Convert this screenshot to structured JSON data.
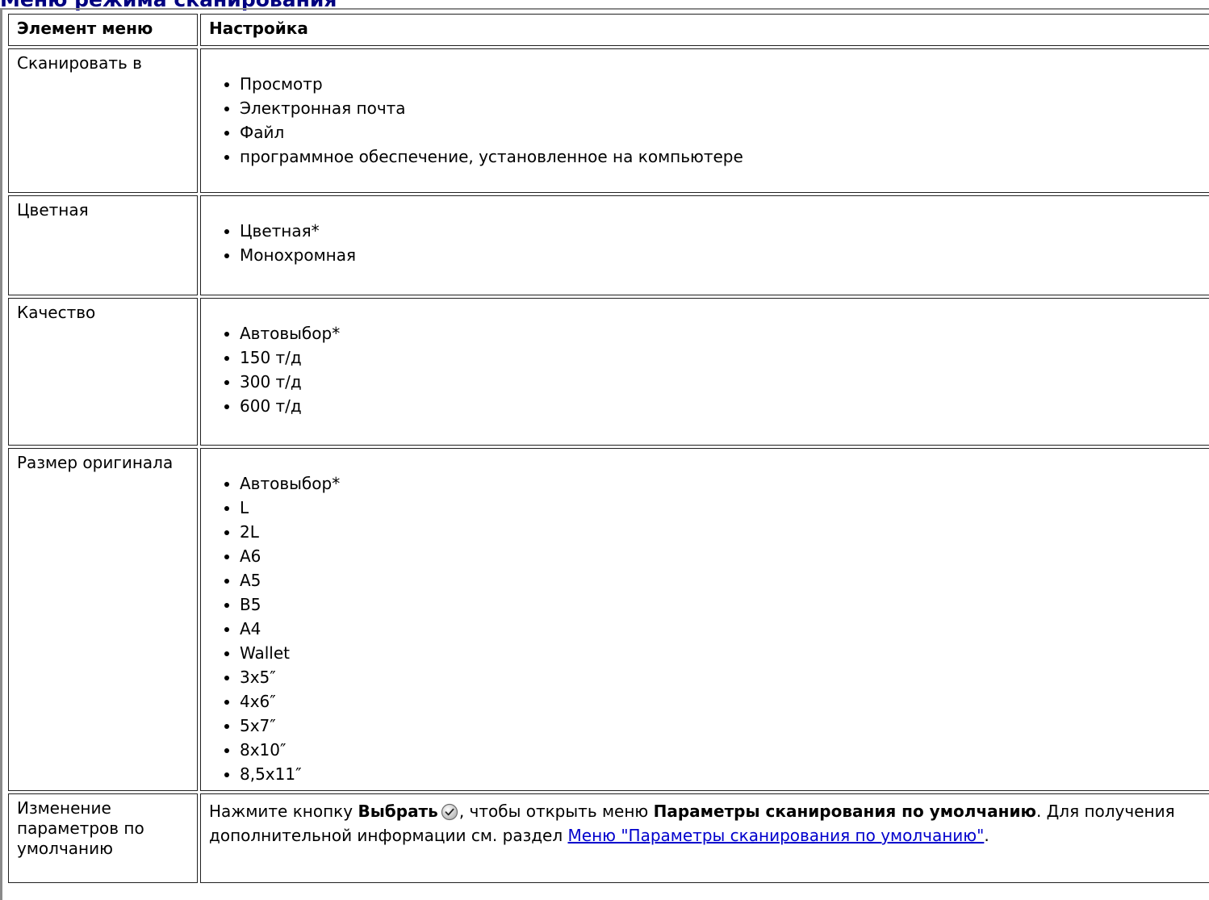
{
  "heading": "Меню режима сканирования",
  "table": {
    "header_item": "Элемент меню",
    "header_setting": "Настройка",
    "rows": [
      {
        "item": "Сканировать в",
        "options": [
          "Просмотр",
          "Электронная почта",
          "Файл",
          "программное обеспечение, установленное на компьютере"
        ]
      },
      {
        "item": "Цветная",
        "options": [
          "Цветная*",
          "Монохромная"
        ]
      },
      {
        "item": "Качество",
        "options": [
          "Автовыбор*",
          "150 т/д",
          "300 т/д",
          "600 т/д"
        ]
      },
      {
        "item": "Размер оригинала",
        "options": [
          "Автовыбор*",
          "L",
          "2L",
          "A6",
          "A5",
          "B5",
          "A4",
          "Wallet",
          "3x5″",
          "4x6″",
          "5x7″",
          "8x10″",
          "8,5x11″"
        ]
      }
    ],
    "defaults_row": {
      "item": "Изменение параметров по умолчанию",
      "text_1": "Нажмите кнопку ",
      "select_label": "Выбрать",
      "select_icon": "checkmark-circle-icon",
      "text_2": ", чтобы открыть меню ",
      "menu_name": "Параметры сканирования по умолчанию",
      "text_3": ". Для получения дополнительной информации см. раздел ",
      "link_text": "Меню \"Параметры сканирования по умолчанию\"",
      "text_4": "."
    }
  },
  "colors": {
    "heading": "#000080",
    "link": "#0000cc",
    "border": "#202020"
  }
}
